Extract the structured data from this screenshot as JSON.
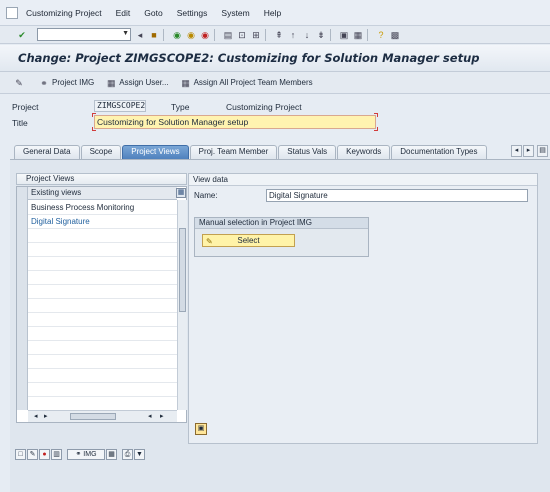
{
  "menubar": {
    "items": [
      "Customizing Project",
      "Edit",
      "Goto",
      "Settings",
      "System",
      "Help"
    ]
  },
  "system_toolbar": {
    "ok_code_value": "",
    "icons": [
      "enter-check-icon",
      "save-icon",
      "back-icon",
      "exit-icon",
      "cancel-icon",
      "print-icon",
      "find-icon",
      "find-next-icon",
      "first-page-icon",
      "prev-page-icon",
      "next-page-icon",
      "last-page-icon",
      "new-session-icon",
      "shortcut-icon",
      "help-icon",
      "layout-icon"
    ]
  },
  "title": "Change: Project ZIMGSCOPE2: Customizing for Solution Manager setup",
  "app_toolbar": {
    "buttons": [
      "Project IMG",
      "Assign User...",
      "Assign All Project Team Members"
    ]
  },
  "header": {
    "project_label": "Project",
    "project_value": "ZIMGSCOPE2",
    "type_label": "Type",
    "type_value": "Customizing Project",
    "title_label": "Title",
    "title_value": "Customizing for Solution Manager setup"
  },
  "tabs": [
    "General Data",
    "Scope",
    "Project Views",
    "Proj. Team Member",
    "Status Vals",
    "Keywords",
    "Documentation Types"
  ],
  "active_tab": "Project Views",
  "project_views": {
    "panel_title": "Project Views",
    "column_header": "Existing views",
    "rows": [
      "Business Process Monitoring",
      "Digital Signature"
    ],
    "selected_row": "Digital Signature",
    "buttons": [
      "create-icon",
      "edit-icon",
      "delete-icon",
      "trash-icon",
      "IMG",
      "detail-icon",
      "print-icon",
      "filter-icon"
    ],
    "img_button_label": "IMG"
  },
  "view_data": {
    "panel_title": "View data",
    "name_label": "Name:",
    "name_value": "Digital Signature",
    "manual_selection_title": "Manual selection in Project IMG",
    "select_button": "Select"
  },
  "colors": {
    "active_tab": "#4f81bd",
    "edit_field": "#fff3b0",
    "selected_row_text": "#1f5f9e"
  }
}
